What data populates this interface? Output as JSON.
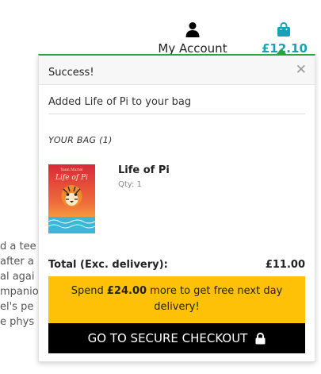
{
  "header": {
    "account": {
      "label": "My Account",
      "icon": "user-icon"
    },
    "bag": {
      "total": "£12.10",
      "icon": "shopping-bag-icon"
    }
  },
  "background_text": [
    "d a tee",
    "after a",
    "al agai",
    "mpanio",
    "el's pe",
    "e phys"
  ],
  "toast": {
    "title": "Success!",
    "close_icon": "close-icon",
    "message": "Added Life of Pi to your bag",
    "bag_heading": "YOUR BAG (1)",
    "item": {
      "name": "Life of Pi",
      "qty": "Qty: 1",
      "cover_author": "Yann Martel",
      "cover_title": "Life of Pi"
    },
    "total_label": "Total (Exc. delivery):",
    "total_value": "£11.00",
    "free_delivery": {
      "prefix": "Spend ",
      "amount": "£24.00",
      "suffix": " more to get free next day delivery!"
    },
    "checkout_label": "GO TO SECURE CHECKOUT",
    "checkout_icon": "lock-icon"
  },
  "colors": {
    "success": "#28a745",
    "bag_accent": "#17a2b8",
    "banner": "#ffc107",
    "checkout": "#000000"
  }
}
